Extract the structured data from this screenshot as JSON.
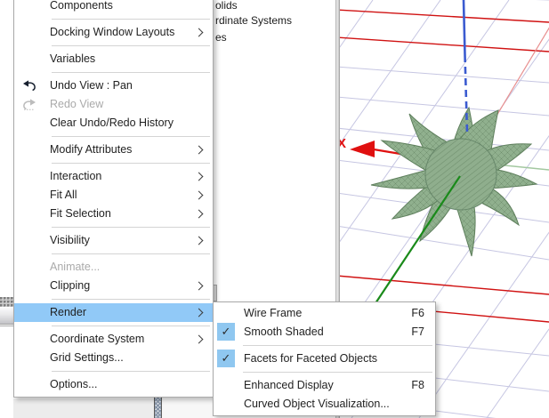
{
  "context_menu": {
    "items": [
      {
        "label": "Components",
        "type": "item"
      },
      {
        "type": "separator"
      },
      {
        "label": "Docking Window Layouts",
        "type": "item",
        "submenu": true
      },
      {
        "type": "separator"
      },
      {
        "label": "Variables",
        "type": "item"
      },
      {
        "type": "separator"
      },
      {
        "label": "Undo View : Pan",
        "type": "item",
        "icon": "undo-icon"
      },
      {
        "label": "Redo View",
        "type": "item",
        "icon": "redo-icon",
        "disabled": true
      },
      {
        "label": "Clear Undo/Redo History",
        "type": "item"
      },
      {
        "type": "separator"
      },
      {
        "label": "Modify Attributes",
        "type": "item",
        "submenu": true
      },
      {
        "type": "separator"
      },
      {
        "label": "Interaction",
        "type": "item",
        "submenu": true
      },
      {
        "label": "Fit All",
        "type": "item",
        "submenu": true
      },
      {
        "label": "Fit Selection",
        "type": "item",
        "submenu": true
      },
      {
        "type": "separator"
      },
      {
        "label": "Visibility",
        "type": "item",
        "submenu": true
      },
      {
        "type": "separator"
      },
      {
        "label": "Animate...",
        "type": "item",
        "disabled": true
      },
      {
        "label": "Clipping",
        "type": "item",
        "submenu": true
      },
      {
        "type": "separator"
      },
      {
        "label": "Render",
        "type": "item",
        "submenu": true,
        "highlighted": true
      },
      {
        "type": "separator"
      },
      {
        "label": "Coordinate System",
        "type": "item",
        "submenu": true
      },
      {
        "label": "Grid Settings...",
        "type": "item"
      },
      {
        "type": "separator"
      },
      {
        "label": "Options...",
        "type": "item"
      }
    ]
  },
  "render_submenu": {
    "items": [
      {
        "label": "Wire Frame",
        "shortcut": "F6"
      },
      {
        "label": "Smooth Shaded",
        "shortcut": "F7",
        "checked": true
      },
      {
        "type": "separator"
      },
      {
        "label": "Facets for Faceted Objects",
        "checked": true
      },
      {
        "type": "separator"
      },
      {
        "label": "Enhanced Display",
        "shortcut": "F8"
      },
      {
        "label": "Curved Object Visualization..."
      }
    ]
  },
  "tree_panel": {
    "visible_fragments": [
      "olids",
      "rdinate Systems",
      "es"
    ]
  },
  "viewport": {
    "x_axis_label": "X",
    "colors": {
      "grid_minor": "#c6c6e2",
      "grid_major": "#d01212",
      "x_axis": "#e01010",
      "y_axis": "#1a8a1a",
      "z_axis": "#3b5bd0",
      "object_fill": "#90b08e",
      "menu_highlight": "#91c9f7",
      "check_background": "#8fc7f0"
    }
  }
}
